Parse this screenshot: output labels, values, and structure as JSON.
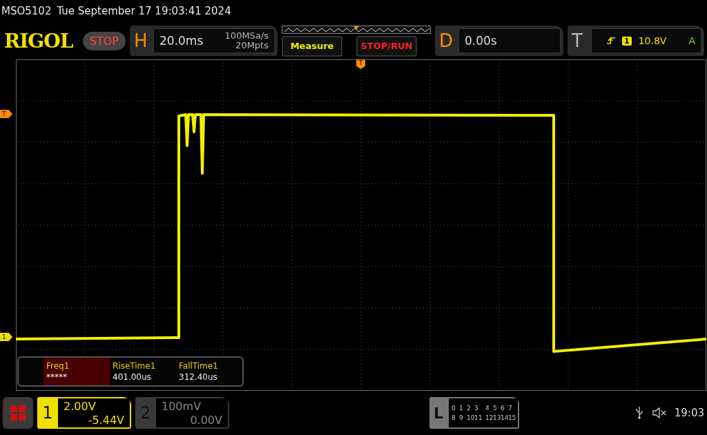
{
  "status_line": {
    "model": "MSO5102",
    "datetime": "Tue September 17 19:03:41 2024"
  },
  "header": {
    "logo": "RIGOL",
    "run_state": "STOP",
    "horizontal": {
      "label": "H",
      "timebase": "20.0ms",
      "sample_rate": "100MSa/s",
      "memory_depth": "20Mpts"
    },
    "buttons": [
      {
        "label": "Measure",
        "kind": "measure"
      },
      {
        "label": "STOP/RUN",
        "kind": "run"
      }
    ],
    "delay": {
      "label": "D",
      "value": "0.00s"
    },
    "trigger": {
      "label": "T",
      "source": "1",
      "level": "10.8V",
      "mode": "A"
    }
  },
  "display": {
    "trigger_position_marker": "T",
    "trigger_level_marker": "T",
    "channel_marker": "1"
  },
  "measurements": [
    {
      "name": "Freq1",
      "value": "*****",
      "selected": true
    },
    {
      "name": "RiseTime1",
      "value": "401.00us",
      "selected": false
    },
    {
      "name": "FallTime1",
      "value": "312.40us",
      "selected": false
    }
  ],
  "channels": [
    {
      "number": "1",
      "scale": "2.00V",
      "offset": "-5.44V",
      "selected": true
    },
    {
      "number": "2",
      "scale": "100mV",
      "offset": "0.00V",
      "selected": false
    }
  ],
  "logic": {
    "label": "L",
    "rows": [
      [
        "0",
        "1",
        "2",
        "3",
        "4",
        "5",
        "6",
        "7"
      ],
      [
        "8",
        "9",
        "10",
        "11",
        "12",
        "13",
        "14",
        "15"
      ]
    ]
  },
  "status_bar": {
    "time": "19:03"
  }
}
